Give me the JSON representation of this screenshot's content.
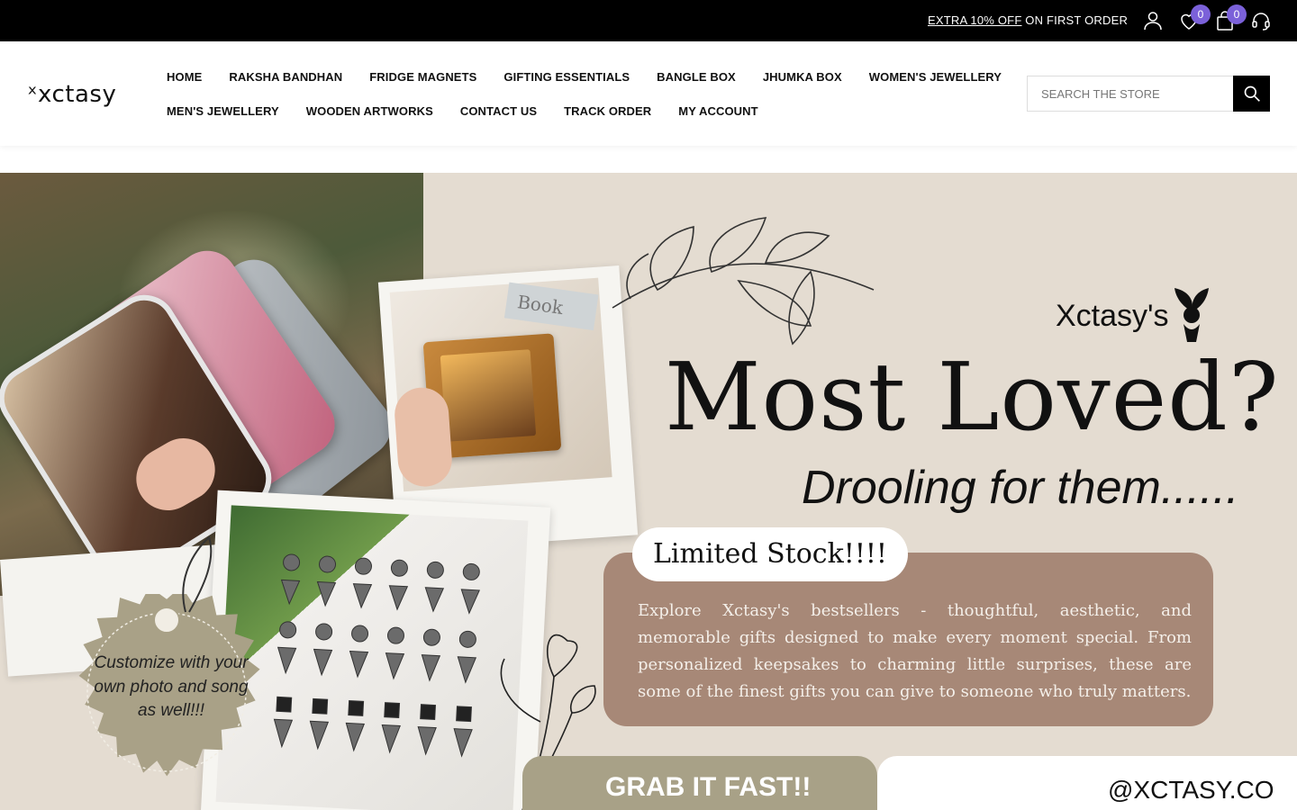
{
  "topbar": {
    "promo_highlight": "EXTRA 10% OFF",
    "promo_rest": " ON FIRST ORDER",
    "wishlist_count": "0",
    "cart_count": "0"
  },
  "header": {
    "logo": "ˣxctasy",
    "nav_row1": [
      "HOME",
      "RAKSHA BANDHAN",
      "FRIDGE MAGNETS",
      "GIFTING ESSENTIALS",
      "BANGLE BOX",
      "JHUMKA BOX",
      "WOMEN'S JEWELLERY"
    ],
    "nav_row2": [
      "MEN'S JEWELLERY",
      "WOODEN ARTWORKS",
      "CONTACT US",
      "TRACK ORDER",
      "MY ACCOUNT"
    ],
    "search_placeholder": "SEARCH THE STORE"
  },
  "hero": {
    "brand": "Xctasy's",
    "title": "Most Loved?",
    "subtitle": "Drooling for them......",
    "limited": "Limited Stock!!!!",
    "description": "Explore Xctasy's bestsellers - thoughtful, aesthetic, and memorable gifts designed to make every moment special. From personalized keepsakes to charming little surprises, these are some of the finest gifts you can give to someone who truly matters.",
    "seal": "Customize with your own photo and song as well!!!",
    "grab": "GRAB IT FAST!!",
    "handle": "@XCTASY.CO",
    "book_label": "Book"
  },
  "colors": {
    "topbar": "#000000",
    "badge": "#7b61d9",
    "hero_bg": "#e4dcd1",
    "desc_box": "#a78877",
    "grab_box": "#a8a187"
  }
}
